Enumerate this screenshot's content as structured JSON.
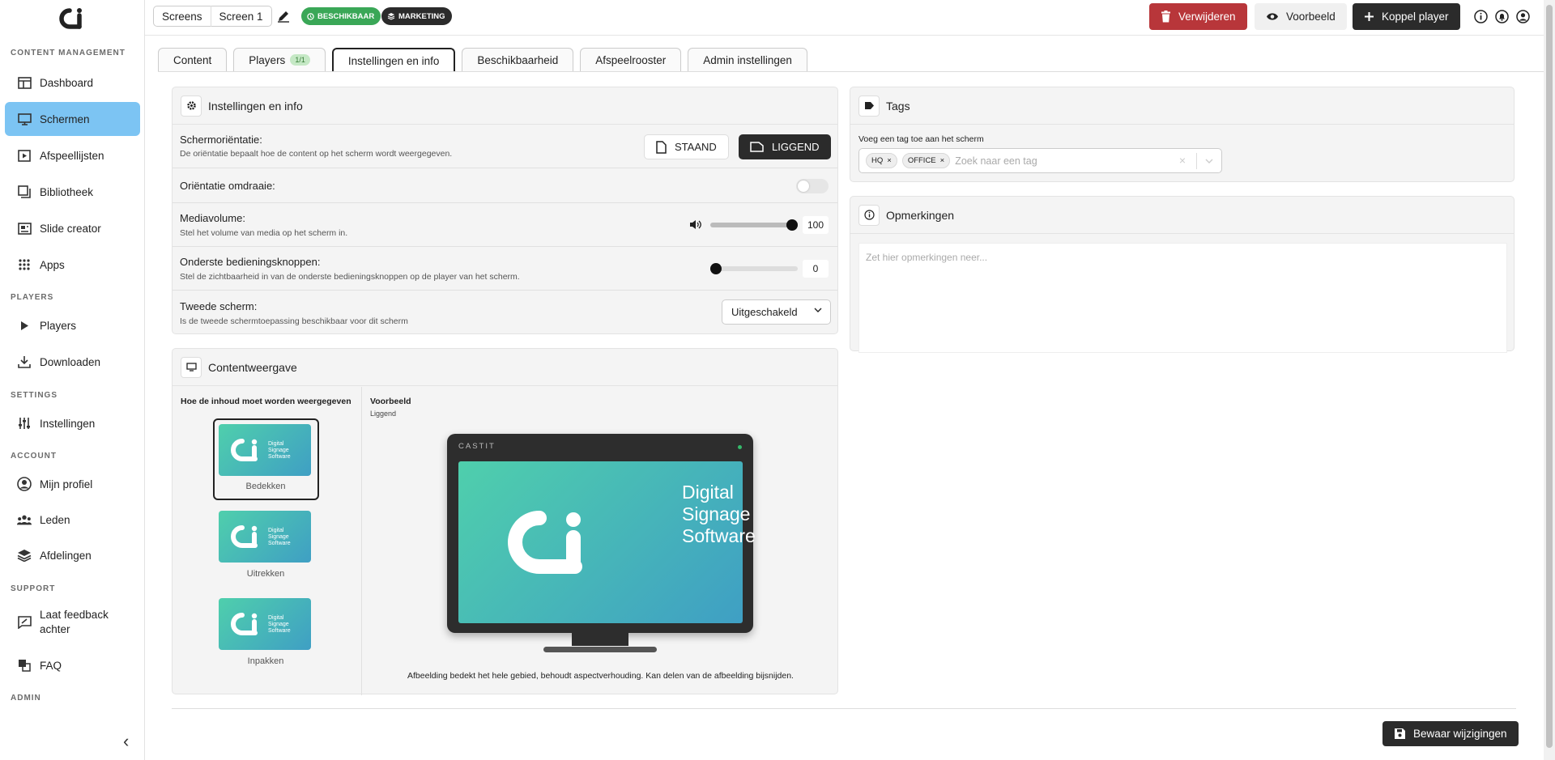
{
  "sidebar": {
    "sections": {
      "content": "CONTENT MANAGEMENT",
      "players": "PLAYERS",
      "settings": "SETTINGS",
      "account": "ACCOUNT",
      "support": "SUPPORT",
      "admin": "ADMIN"
    },
    "items": {
      "dashboard": "Dashboard",
      "schermen": "Schermen",
      "afspeellijsten": "Afspeellijsten",
      "bibliotheek": "Bibliotheek",
      "slide_creator": "Slide creator",
      "apps": "Apps",
      "players": "Players",
      "downloaden": "Downloaden",
      "instellingen": "Instellingen",
      "mijn_profiel": "Mijn profiel",
      "leden": "Leden",
      "afdelingen": "Afdelingen",
      "feedback_1": "Laat feedback",
      "feedback_2": "achter",
      "faq": "FAQ"
    }
  },
  "topbar": {
    "breadcrumb": [
      "Screens",
      "Screen 1"
    ],
    "badge_available": "BESCHIKBAAR",
    "badge_marketing": "MARKETING",
    "delete_label": "Verwijderen",
    "preview_label": "Voorbeeld",
    "link_label": "Koppel player"
  },
  "tabs": {
    "content": "Content",
    "players": "Players",
    "players_count": "1/1",
    "settings": "Instellingen en info",
    "availability": "Beschikbaarheid",
    "schedule": "Afspeelrooster",
    "admin": "Admin instellingen"
  },
  "settings_panel": {
    "title": "Instellingen en info",
    "orientation_label": "Schermoriëntatie:",
    "orientation_desc": "De oriëntatie bepaalt hoe de content op het scherm wordt weergegeven.",
    "portrait": "STAAND",
    "landscape": "LIGGEND",
    "flip_label": "Oriëntatie omdraaie:",
    "volume_label": "Mediavolume:",
    "volume_desc": "Stel het volume van media op het scherm in.",
    "volume_value": "100",
    "volume_level": 1.0,
    "controls_label": "Onderste bedieningsknoppen:",
    "controls_desc": "Stel de zichtbaarheid in van de onderste bedieningsknoppen op de player van het scherm.",
    "controls_value": "0",
    "controls_level": 0.0,
    "second_label": "Tweede scherm:",
    "second_desc": "Is de tweede schermtoepassing beschikbaar voor dit scherm",
    "second_value": "Uitgeschakeld"
  },
  "display_panel": {
    "title": "Contentweergave",
    "left_heading": "Hoe de inhoud moet worden weergegeven",
    "options": [
      "Bedekken",
      "Uitrekken",
      "Inpakken"
    ],
    "preview_heading": "Voorbeeld",
    "preview_sub": "Liggend",
    "brand": "CASTIT",
    "logo_text": [
      "Digital",
      "Signage",
      "Software"
    ],
    "caption": "Afbeelding bedekt het hele gebied, behoudt aspectverhouding. Kan delen van de afbeelding bijsnijden."
  },
  "tags_panel": {
    "title": "Tags",
    "label": "Voeg een tag toe aan het scherm",
    "chips": [
      "HQ",
      "OFFICE"
    ],
    "placeholder": "Zoek naar een tag"
  },
  "notes_panel": {
    "title": "Opmerkingen",
    "placeholder": "Zet hier opmerkingen neer..."
  },
  "save_label": "Bewaar wijzigingen",
  "colors": {
    "active_nav": "#7cc4f3",
    "badge_green": "#3aa757",
    "badge_dark": "#2b2b2b",
    "delete_red": "#b8363a",
    "screen_gradient_start": "#4fcfac",
    "screen_gradient_end": "#3f9fc4"
  }
}
